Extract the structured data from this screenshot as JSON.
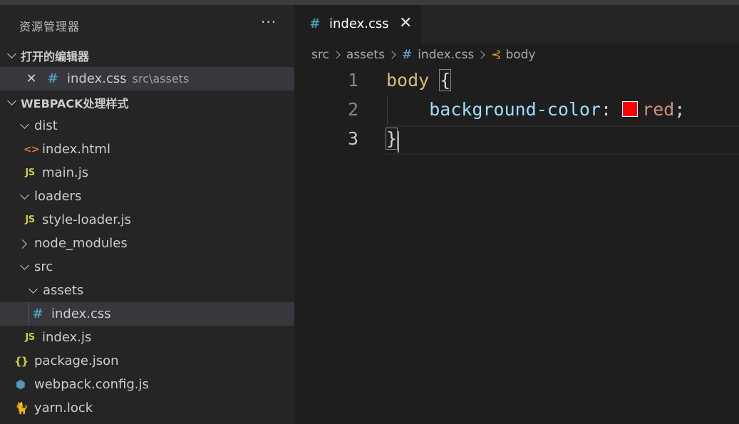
{
  "sidebar": {
    "title": "资源管理器",
    "more": "···",
    "open_editors": {
      "label": "打开的编辑器",
      "items": [
        {
          "close": "✕",
          "icon": "#",
          "name": "index.css",
          "path": "src\\assets"
        }
      ]
    },
    "project": {
      "label": "WEBPACK处理样式",
      "tree": {
        "dist": "dist",
        "dist_index_html": "index.html",
        "dist_main_js": "main.js",
        "loaders": "loaders",
        "style_loader_js": "style-loader.js",
        "node_modules": "node_modules",
        "src": "src",
        "assets": "assets",
        "index_css": "index.css",
        "index_js": "index.js",
        "package_json": "package.json",
        "webpack_config_js": "webpack.config.js",
        "yarn_lock": "yarn.lock"
      }
    },
    "icons": {
      "css": "#",
      "js": "JS",
      "html": "<>",
      "json": "{}",
      "webpack": "⬢",
      "yarn": "🐈"
    }
  },
  "editor": {
    "tab": {
      "icon": "#",
      "label": "index.css",
      "close": "✕"
    },
    "breadcrumb": {
      "src": "src",
      "assets": "assets",
      "file": "index.css",
      "symbol": "body"
    },
    "code": {
      "line_numbers": [
        "1",
        "2",
        "3"
      ],
      "selector": "body",
      "open_brace": "{",
      "property": "background-color",
      "colon": ":",
      "value": "red",
      "semicolon": ";",
      "close_brace": "}",
      "swatch_color": "#ff0000"
    }
  },
  "colors": {
    "sidebar_bg": "#252526",
    "editor_bg": "#1e1e1e",
    "selection": "#37373d",
    "css_icon": "#519aba",
    "js_icon": "#cbcb41",
    "html_icon": "#e37933"
  }
}
